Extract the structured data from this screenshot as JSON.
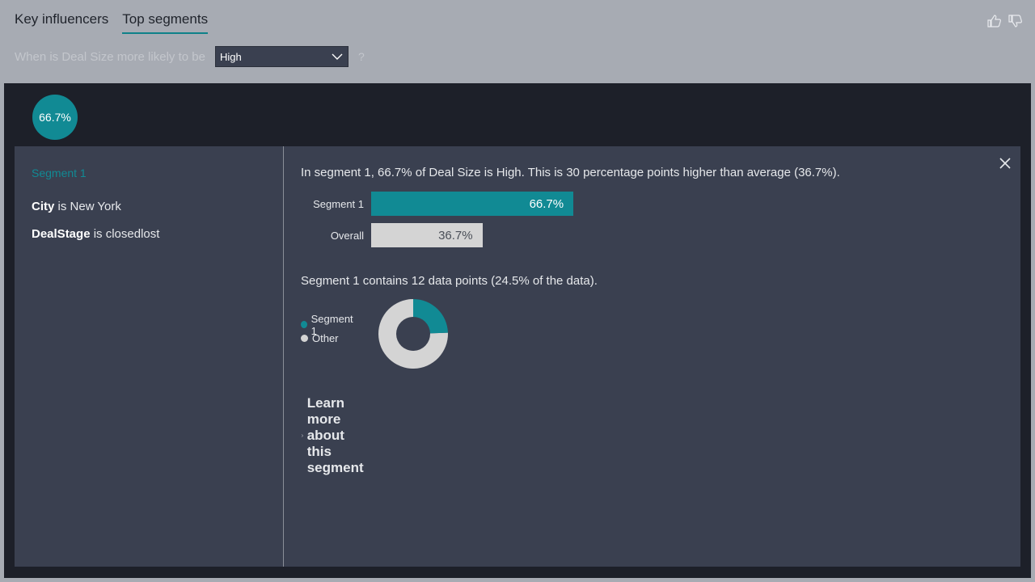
{
  "tabs": [
    {
      "label": "Key influencers",
      "active": false
    },
    {
      "label": "Top segments",
      "active": true
    }
  ],
  "feedback": {
    "like_icon": "thumbs-up-icon",
    "dislike_icon": "thumbs-down-icon"
  },
  "question": {
    "text": "When is Deal Size more likely to be",
    "selected": "High",
    "help": "?"
  },
  "bubble": {
    "label": "66.7%"
  },
  "segment": {
    "title": "Segment 1",
    "conditions": [
      {
        "field": "City",
        "op": "is New York"
      },
      {
        "field": "DealStage",
        "op": "is closedlost"
      }
    ],
    "summary": "In segment 1, 66.7% of Deal Size is High. This is 30 percentage points higher than average (36.7%).",
    "bars": [
      {
        "label": "Segment 1",
        "value_label": "66.7%",
        "value": 66.7
      },
      {
        "label": "Overall",
        "value_label": "36.7%",
        "value": 36.7
      }
    ],
    "contains": "Segment 1 contains 12 data points (24.5% of the data).",
    "legend": [
      {
        "label": "Segment 1",
        "color": "#118a94"
      },
      {
        "label": "Other",
        "color": "#d4d4d4"
      }
    ],
    "donut_share": 24.5,
    "learn_more": "Learn more about this segment"
  },
  "colors": {
    "accent": "#118a94",
    "overall_bar": "#d4d4d4",
    "panel": "#3a4050"
  }
}
